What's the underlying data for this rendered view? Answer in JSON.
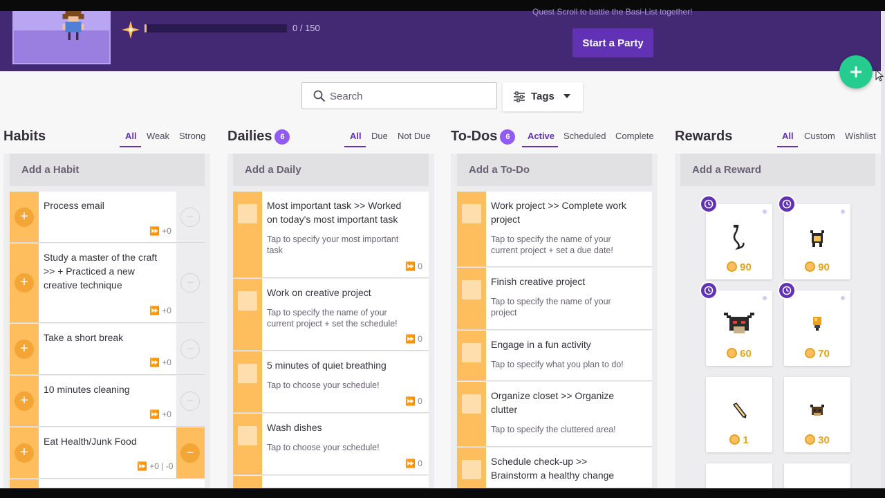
{
  "header": {
    "xp_text": "0 / 150",
    "xp_fraction": 0.01,
    "quest_text": "Quest Scroll to battle the Basi-List together!",
    "party_button": "Start a Party"
  },
  "search": {
    "placeholder": "Search"
  },
  "tags": {
    "label": "Tags"
  },
  "habits": {
    "title": "Habits",
    "tabs": [
      "All",
      "Weak",
      "Strong"
    ],
    "add_label": "Add a Habit",
    "items": [
      {
        "title": "Process email",
        "streak": "+0"
      },
      {
        "title": "Study a master of the craft >> + Practiced a new creative technique",
        "streak": "+0"
      },
      {
        "title": "Take a short break",
        "streak": "+0"
      },
      {
        "title": "10 minutes cleaning",
        "streak": "+0"
      },
      {
        "title": "Eat Health/Junk Food",
        "streak": "+0 | -0"
      }
    ]
  },
  "dailies": {
    "title": "Dailies",
    "count": "6",
    "tabs": [
      "All",
      "Due",
      "Not Due"
    ],
    "add_label": "Add a Daily",
    "items": [
      {
        "title": "Most important task >> Worked on today's most important task",
        "note": "Tap to specify your most important task",
        "streak": "0"
      },
      {
        "title": "Work on creative project",
        "note": "Tap to specify the name of your current project + set the schedule!",
        "streak": "0"
      },
      {
        "title": "5 minutes of quiet breathing",
        "note": "Tap to choose your schedule!",
        "streak": "0"
      },
      {
        "title": "Wash dishes",
        "note": "Tap to choose your schedule!",
        "streak": "0"
      }
    ]
  },
  "todos": {
    "title": "To-Dos",
    "count": "6",
    "tabs": [
      "Active",
      "Scheduled",
      "Complete"
    ],
    "add_label": "Add a To-Do",
    "items": [
      {
        "title": "Work project >> Complete work project",
        "note": "Tap to specify the name of your current project + set a due date!"
      },
      {
        "title": "Finish creative project",
        "note": "Tap to specify the name of your project"
      },
      {
        "title": "Engage in a fun activity",
        "note": "Tap to specify what you plan to do!"
      },
      {
        "title": "Organize closet >> Organize clutter",
        "note": "Tap to specify the cluttered area!"
      },
      {
        "title": "Schedule check-up >> Brainstorm a healthy change",
        "note": ""
      }
    ]
  },
  "rewards": {
    "title": "Rewards",
    "tabs": [
      "All",
      "Custom",
      "Wishlist"
    ],
    "add_label": "Add a Reward",
    "items": [
      {
        "price": "90",
        "icon": "whip-icon"
      },
      {
        "price": "90",
        "icon": "cow-icon"
      },
      {
        "price": "60",
        "icon": "bull-mask-icon"
      },
      {
        "price": "70",
        "icon": "lightbulb-icon"
      },
      {
        "price": "1",
        "icon": "pencil-icon"
      },
      {
        "price": "30",
        "icon": "bull-icon"
      }
    ]
  },
  "colors": {
    "header": "#432874",
    "accent": "#6133b4",
    "task_orange": "#ffbe5d",
    "fab": "#24cc8f"
  }
}
